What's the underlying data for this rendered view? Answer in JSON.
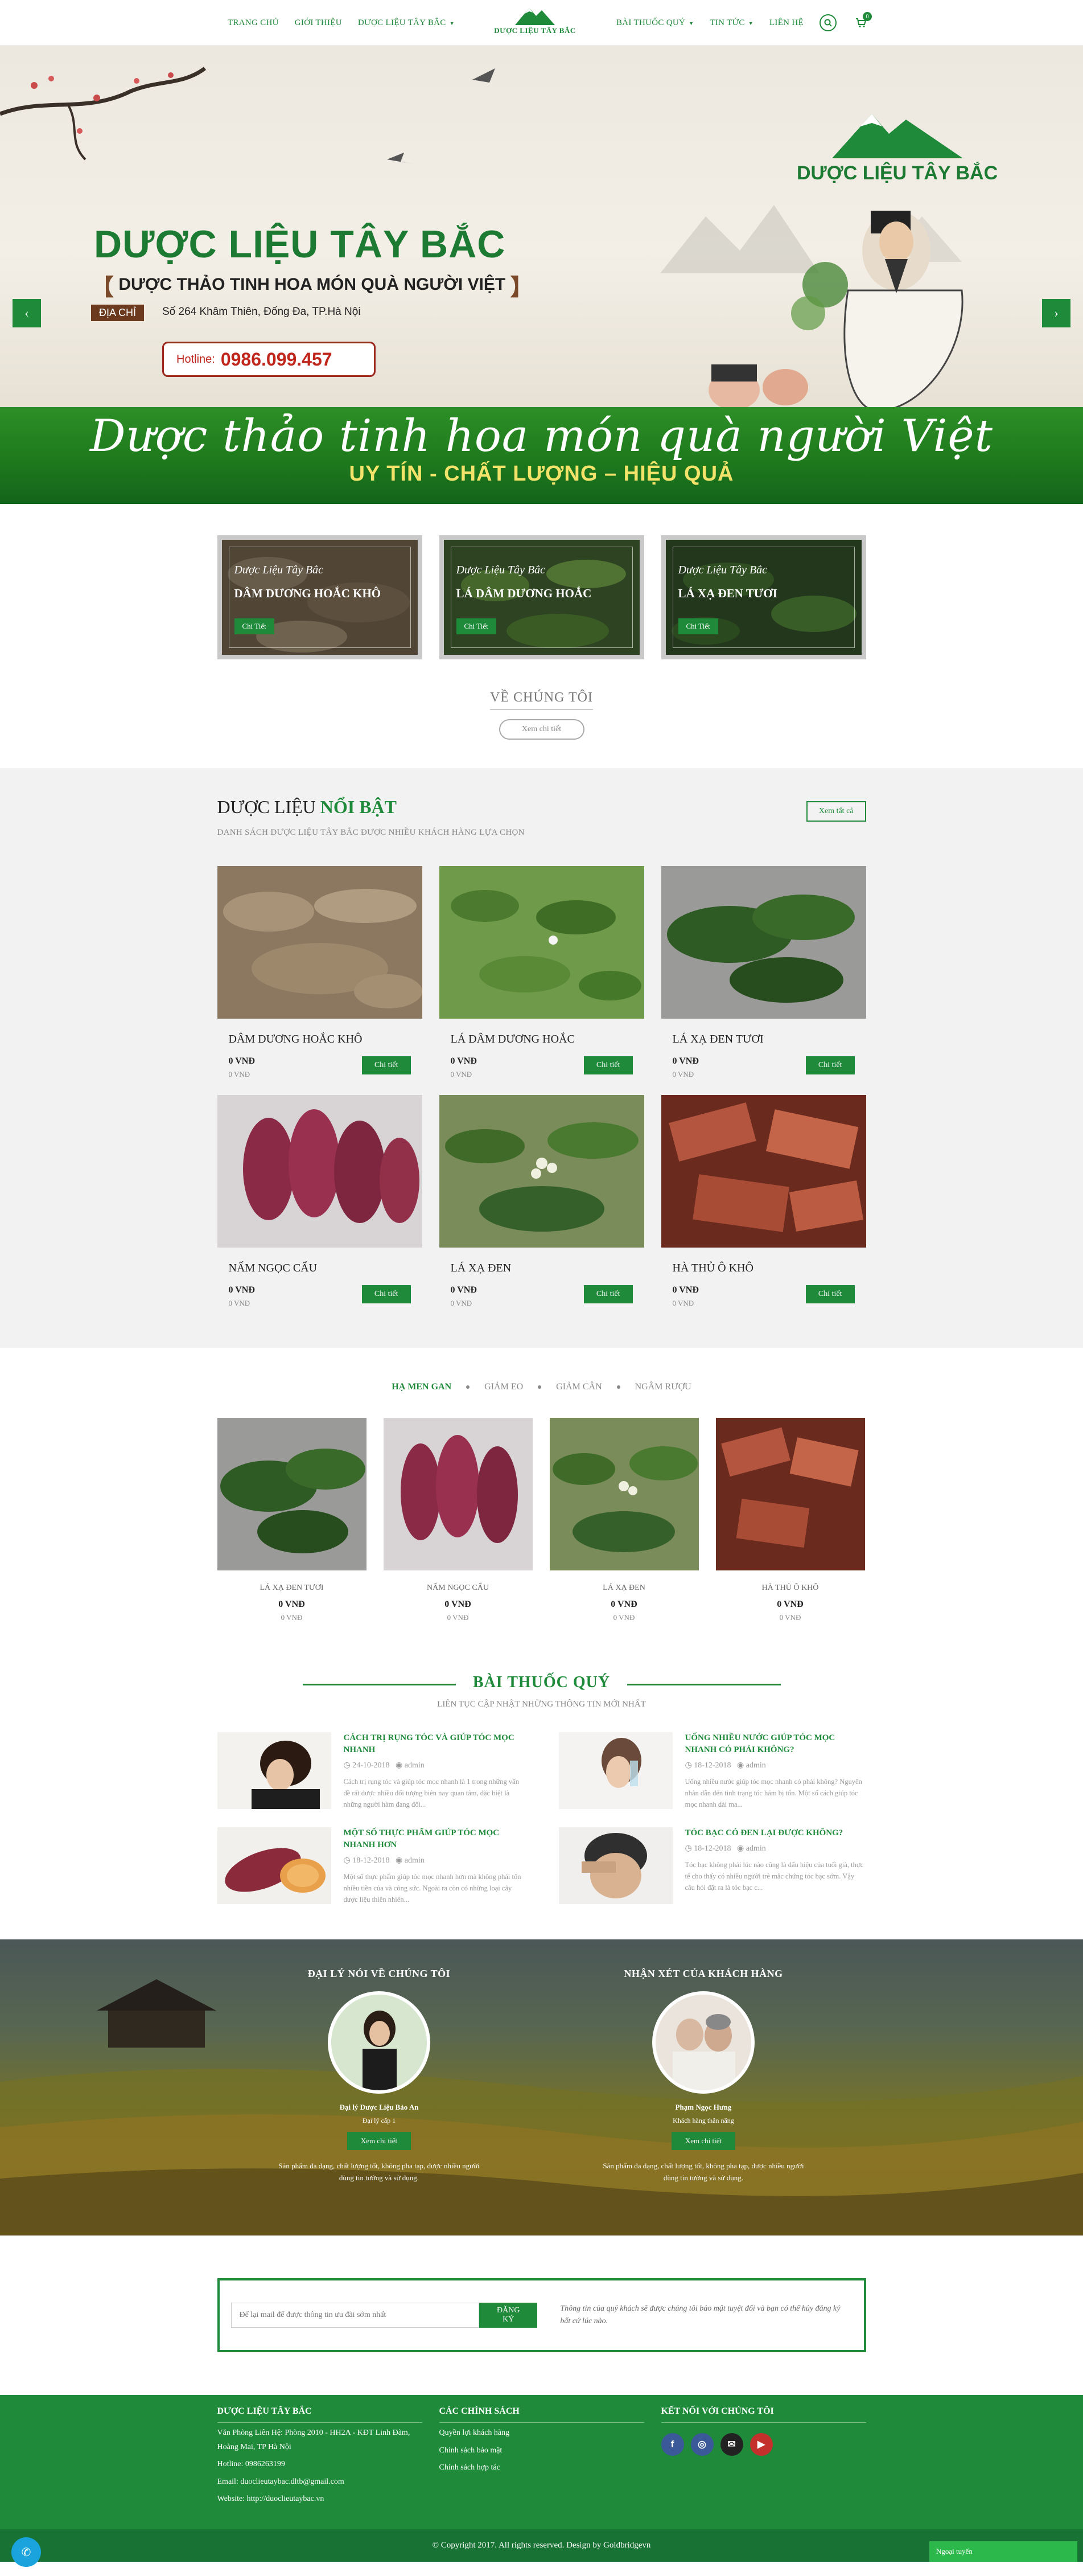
{
  "nav": {
    "left": [
      {
        "label": "TRANG CHỦ"
      },
      {
        "label": "GIỚI THIỆU"
      },
      {
        "label": "DƯỢC LIỆU TÂY BẮC"
      }
    ],
    "right": [
      {
        "label": "BÀI THUỐC QUÝ"
      },
      {
        "label": "TIN TỨC"
      },
      {
        "label": "LIÊN HỆ"
      }
    ],
    "logo_text": "DƯỢC LIỆU TÂY BẮC",
    "cart_count": "0"
  },
  "slider": {
    "title": "DƯỢC LIỆU TÂY BẮC",
    "subtitle": "DƯỢC THẢO TINH HOA MÓN QUÀ NGƯỜI VIỆT",
    "address_label": "ĐỊA CHỈ",
    "address": "Số 264 Khâm Thiên, Đống Đa, TP.Hà Nội",
    "hotline_label": "Hotline:",
    "hotline": "0986.099.457",
    "logo_text": "DƯỢC LIỆU TÂY BẮC",
    "band_script": "Dược thảo tinh hoa món quà người Việt",
    "band_line": "UY TÍN - CHẤT LƯỢNG – HIỆU QUẢ"
  },
  "categories": [
    {
      "small": "Dược Liệu Tây Bắc",
      "name": "DÂM DƯƠNG HOẮC KHÔ",
      "button": "Chi Tiết"
    },
    {
      "small": "Dược Liệu Tây Bắc",
      "name": "LÁ DÂM DƯƠNG HOẮC",
      "button": "Chi Tiết"
    },
    {
      "small": "Dược Liệu Tây Bắc",
      "name": "LÁ XẠ ĐEN TƯƠI",
      "button": "Chi Tiết"
    }
  ],
  "about": {
    "title": "VỀ CHÚNG TÔI",
    "button": "Xem chi tiết"
  },
  "featured": {
    "title_a": "DƯỢC LIỆU",
    "title_b": "NỔI BẬT",
    "desc": "DANH SÁCH DƯỢC LIỆU TÂY BẮC ĐƯỢC NHIỀU KHÁCH HÀNG LỰA CHỌN",
    "see_all": "Xem tất cả",
    "products": [
      {
        "name": "DÂM DƯƠNG HOẮC KHÔ",
        "price": "0",
        "unit": "VNĐ",
        "old": "0 VNĐ",
        "button": "Chi tiết"
      },
      {
        "name": "LÁ DÂM DƯƠNG HOẮC",
        "price": "0",
        "unit": "VNĐ",
        "old": "0 VNĐ",
        "button": "Chi tiết"
      },
      {
        "name": "LÁ XẠ ĐEN TƯƠI",
        "price": "0",
        "unit": "VNĐ",
        "old": "0 VNĐ",
        "button": "Chi tiết"
      },
      {
        "name": "NẤM NGỌC CẨU",
        "price": "0",
        "unit": "VNĐ",
        "old": "0 VNĐ",
        "button": "Chi tiết"
      },
      {
        "name": "LÁ XẠ ĐEN",
        "price": "0",
        "unit": "VNĐ",
        "old": "0 VNĐ",
        "button": "Chi tiết"
      },
      {
        "name": "HÀ THỦ Ô KHÔ",
        "price": "0",
        "unit": "VNĐ",
        "old": "0 VNĐ",
        "button": "Chi tiết"
      }
    ]
  },
  "tabs": {
    "items": [
      "HẠ MEN GAN",
      "GIẢM EO",
      "GIẢM CÂN",
      "NGÂM RƯỢU"
    ],
    "products": [
      {
        "name": "LÁ XẠ ĐEN TƯƠI",
        "price": "0",
        "unit": "VNĐ",
        "old": "0 VNĐ"
      },
      {
        "name": "NẤM NGỌC CẨU",
        "price": "0",
        "unit": "VNĐ",
        "old": "0 VNĐ"
      },
      {
        "name": "LÁ XẠ ĐEN",
        "price": "0",
        "unit": "VNĐ",
        "old": "0 VNĐ"
      },
      {
        "name": "HÀ THỦ Ô KHÔ",
        "price": "0",
        "unit": "VNĐ",
        "old": "0 VNĐ"
      }
    ]
  },
  "news": {
    "title": "BÀI THUỐC QUÝ",
    "sub": "LIÊN TỤC CẬP NHẬT NHỮNG THÔNG TIN MỚI NHẤT",
    "items": [
      {
        "title": "CÁCH TRỊ RỤNG TÓC VÀ GIÚP TÓC MỌC NHANH",
        "date": "24-10-2018",
        "author": "admin",
        "excerpt": "Cách trị rụng tóc và giúp tóc mọc nhanh là 1 trong những vấn đề rất được nhiều đối tượng biên nay quan tâm, đặc biệt là những người hàm đang đối..."
      },
      {
        "title": "UỐNG NHIỀU NƯỚC GIÚP TÓC MỌC NHANH CÓ PHẢI KHÔNG?",
        "date": "18-12-2018",
        "author": "admin",
        "excerpt": "Uống nhiều nước giúp tóc mọc nhanh có phải không? Nguyên nhân dẫn đến tình trạng tóc hám bị tổn. Một số cách giúp tóc mọc nhanh dài ma..."
      },
      {
        "title": "MỘT SỐ THỰC PHẨM GIÚP TÓC MỌC NHANH HƠN",
        "date": "18-12-2018",
        "author": "admin",
        "excerpt": "Một số thực phẩm giúp tóc mọc nhanh hơn mà không phải tốn nhiều tiền của và công sức. Ngoài ra còn có những loại cây dược liệu thiên nhiên..."
      },
      {
        "title": "TÓC BẠC CÓ ĐEN LẠI ĐƯỢC KHÔNG?",
        "date": "18-12-2018",
        "author": "admin",
        "excerpt": "Tóc bạc không phải lúc nào cũng là dấu hiệu của tuổi già, thực tế cho thấy có nhiều người trẻ mắc chứng tóc bạc sớm. Vậy câu hỏi đặt ra là tóc bạc c..."
      }
    ]
  },
  "testimonials": {
    "left": {
      "heading": "ĐẠI LÝ NÓI VỀ CHÚNG TÔI",
      "person": "Đại lý Dược Liệu Bảo An",
      "role": "Đại lý cấp 1",
      "button": "Xem chi tiết",
      "quote": "Sản phẩm đa dạng, chất lượng tốt, không pha tạp, được nhiều người dùng tin tưởng và sử dụng."
    },
    "right": {
      "heading": "NHẬN XÉT CỦA KHÁCH HÀNG",
      "person": "Phạm Ngọc Hưng",
      "role": "Khách hàng thân năng",
      "button": "Xem chi tiết",
      "quote": "Sản phẩm đa dạng, chất lượng tốt, không pha tạp, được nhiều người dùng tin tưởng và sử dụng."
    }
  },
  "newsletter": {
    "placeholder": "Để lại mail để được thông tin ưu đãi sớm nhất",
    "button": "ĐĂNG KÝ",
    "note": "Thông tin của quý khách sẽ được chúng tôi bảo mật tuyệt đối và bạn có thể hủy đăng ký bất cứ lúc nào."
  },
  "footer": {
    "col1": {
      "title": "DƯỢC LIỆU TÂY BẮC",
      "lines": [
        "Văn Phòng Liên Hệ: Phòng 2010 - HH2A - KĐT Linh Đàm, Hoàng Mai, TP Hà Nội",
        "Hotline: 0986263199",
        "Email: duoclieutaybac.dltb@gmail.com",
        "Website: http://duoclieutaybac.vn"
      ]
    },
    "col2": {
      "title": "CÁC CHÍNH SÁCH",
      "links": [
        "Quyền lợi khách hàng",
        "Chính sách bảo mật",
        "Chính sách hợp tác"
      ]
    },
    "col3": {
      "title": "KẾT NỐI VỚI CHÚNG TÔI",
      "social": [
        {
          "icon": "facebook-icon",
          "glyph": "f",
          "color": "#3b5998"
        },
        {
          "icon": "instagram-icon",
          "glyph": "◎",
          "color": "#3b5998"
        },
        {
          "icon": "email-icon",
          "glyph": "✉",
          "color": "#222222"
        },
        {
          "icon": "youtube-icon",
          "glyph": "▶",
          "color": "#c4302b"
        }
      ]
    },
    "copyright": "© Copyright 2017. All rights reserved. Design by Goldbridgevn",
    "chat": "Ngoại tuyến"
  },
  "colors": {
    "brand": "#1e8a3a",
    "hotline": "#c0261c"
  }
}
